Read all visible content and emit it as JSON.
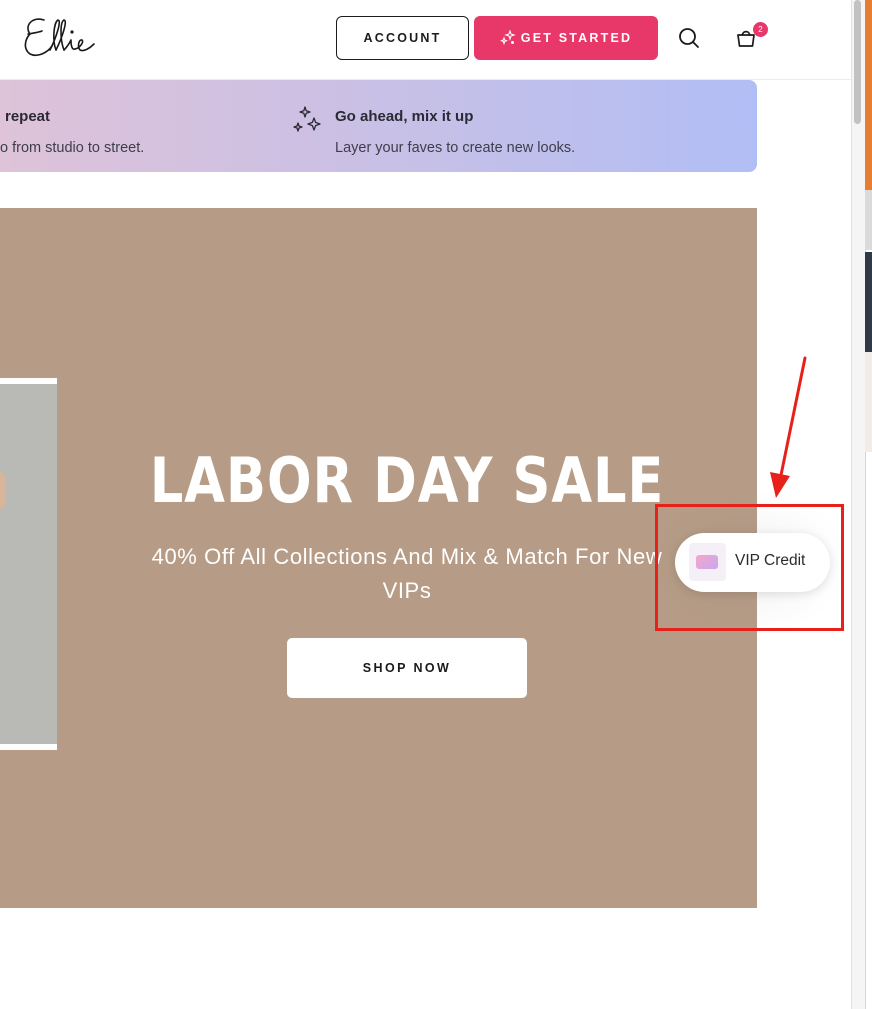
{
  "header": {
    "logo_text": "Ellie",
    "account_label": "ACCOUNT",
    "get_started_label": "GET STARTED",
    "cart_count": "2"
  },
  "benefits": [
    {
      "title": "repeat",
      "description": "o from studio to street."
    },
    {
      "title": "Go ahead, mix it up",
      "description": "Layer your faves to create new looks."
    }
  ],
  "hero": {
    "title": "LABOR DAY SALE",
    "subtitle": "40% Off All Collections And Mix & Match For New VIPs",
    "cta_label": "SHOP NOW"
  },
  "vip": {
    "label": "VIP Credit"
  },
  "colors": {
    "accent_pink": "#e8386a",
    "hero_background": "#b69c86",
    "annotation_red": "#e8201a"
  },
  "icons": [
    "sparkle-icon",
    "search-icon",
    "cart-icon",
    "credit-card-icon",
    "annotation-arrow"
  ]
}
